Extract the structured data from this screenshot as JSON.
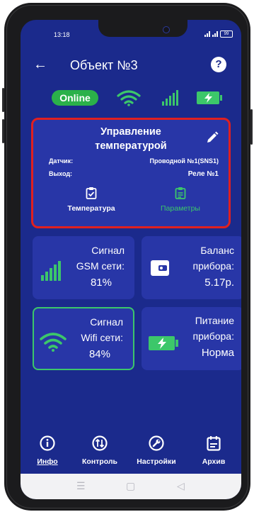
{
  "statusbar": {
    "time": "13:18",
    "battery": "99"
  },
  "header": {
    "back_icon": "arrow-left-icon",
    "title": "Объект №3",
    "help_icon": "question-circle-icon"
  },
  "status": {
    "online": "Online",
    "wifi_icon": "wifi-icon",
    "gsm_icon": "signal-bars-icon",
    "battery_icon": "battery-charging-icon"
  },
  "temperature": {
    "title_line1": "Управление",
    "title_line2": "температурой",
    "sensor_label": "Датчик:",
    "sensor_value": "Проводной №1(SNS1)",
    "output_label": "Выход:",
    "output_value": "Реле №1",
    "tab_temperature": "Температура",
    "tab_parameters": "Параметры"
  },
  "cards": {
    "gsm": {
      "line1": "Сигнал",
      "line2": "GSM сети:",
      "value": "81%"
    },
    "balance": {
      "line1": "Баланс",
      "line2": "прибора:",
      "value": "5.17р."
    },
    "wifi": {
      "line1": "Сигнал",
      "line2": "Wifi сети:",
      "value": "84%"
    },
    "power": {
      "line1": "Питание",
      "line2": "прибора:",
      "value": "Норма"
    }
  },
  "bottom_nav": [
    {
      "label": "Инфо",
      "icon": "info-icon"
    },
    {
      "label": "Контроль",
      "icon": "control-icon"
    },
    {
      "label": "Настройки",
      "icon": "wrench-icon"
    },
    {
      "label": "Архив",
      "icon": "calendar-icon"
    }
  ],
  "colors": {
    "background": "#1b2a8c",
    "card": "#2836a7",
    "accent_green": "#3cc76a",
    "highlight_red": "#e02020"
  }
}
